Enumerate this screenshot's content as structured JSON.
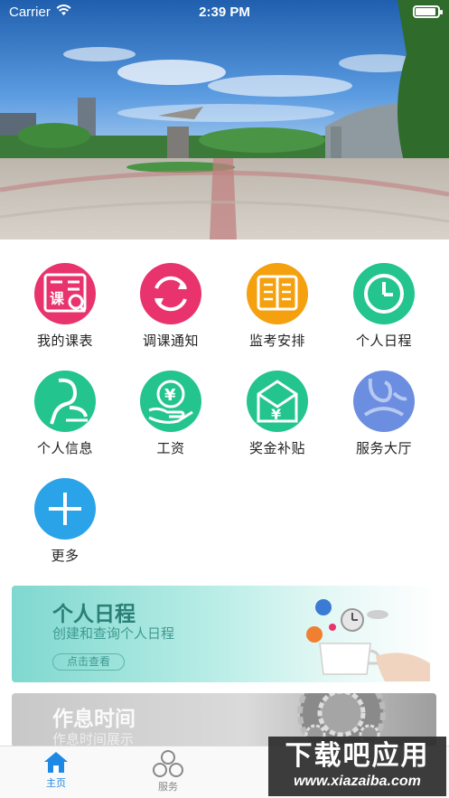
{
  "status_bar": {
    "carrier": "Carrier",
    "time": "2:39 PM"
  },
  "grid": [
    {
      "label": "我的课表",
      "icon": "timetable-icon",
      "color": "#e8336d"
    },
    {
      "label": "调课通知",
      "icon": "refresh-circle-icon",
      "color": "#e8336d"
    },
    {
      "label": "监考安排",
      "icon": "book-icon",
      "color": "#f5a00f"
    },
    {
      "label": "个人日程",
      "icon": "clock-icon",
      "color": "#23c48d"
    },
    {
      "label": "个人信息",
      "icon": "person-icon",
      "color": "#23c48d"
    },
    {
      "label": "工资",
      "icon": "yen-coin-icon",
      "color": "#23c48d"
    },
    {
      "label": "奖金补贴",
      "icon": "yen-envelope-icon",
      "color": "#23c48d"
    },
    {
      "label": "服务大厅",
      "icon": "service-hall-icon",
      "color": "#6b8ee0"
    },
    {
      "label": "更多",
      "icon": "plus-icon",
      "color": "#2aa3e8"
    }
  ],
  "cards": [
    {
      "title": "个人日程",
      "subtitle": "创建和查询个人日程",
      "button": "点击查看"
    },
    {
      "title": "作息时间",
      "subtitle": "作息时间展示"
    }
  ],
  "tabs": [
    {
      "label": "主页",
      "icon": "home-icon",
      "active": true
    },
    {
      "label": "服务",
      "icon": "circles-icon",
      "active": false
    }
  ],
  "watermark": {
    "line1": "下载吧应用",
    "line2": "www.xiazaiba.com"
  }
}
